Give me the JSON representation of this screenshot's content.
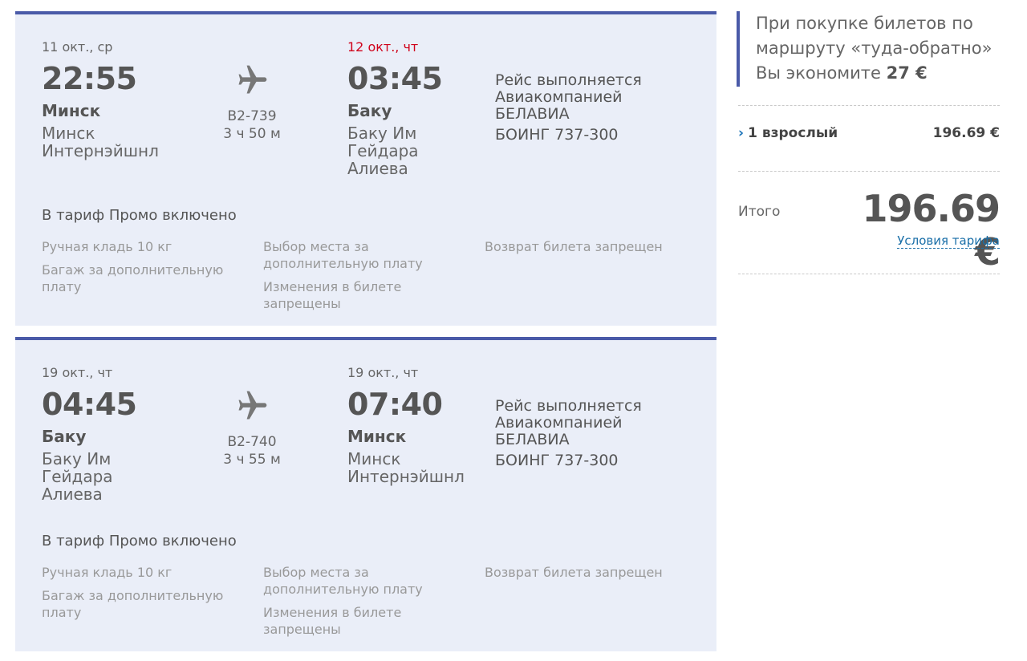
{
  "flights": [
    {
      "dep_date": "11 окт., ср",
      "dep_time": "22:55",
      "dep_city": "Минск",
      "dep_airport": "Минск Интернэйшнл",
      "flight_number": "B2-739",
      "duration": "3 ч 50 м",
      "arr_date": "12 окт., чт",
      "arr_time": "03:45",
      "arr_city": "Баку",
      "arr_airport": "Баку Им Гейдара Алиева",
      "operator": "Рейс выполняется Авиакомпанией БЕЛАВИА",
      "aircraft": "БОИНГ 737-300",
      "tariff_title": "В тариф Промо включено",
      "inc_col1_a": "Ручная кладь 10 кг",
      "inc_col1_b": "Багаж за дополнительную плату",
      "inc_col2_a": "Выбор места за дополнительную плату",
      "inc_col2_b": "Изменения в билете запрещены",
      "inc_col3_a": "Возврат билета запрещен"
    },
    {
      "dep_date": "19 окт., чт",
      "dep_time": "04:45",
      "dep_city": "Баку",
      "dep_airport": "Баку Им Гейдара Алиева",
      "flight_number": "B2-740",
      "duration": "3 ч 55 м",
      "arr_date": "19 окт., чт",
      "arr_time": "07:40",
      "arr_city": "Минск",
      "arr_airport": "Минск Интернэйшнл",
      "operator": "Рейс выполняется Авиакомпанией БЕЛАВИА",
      "aircraft": "БОИНГ 737-300",
      "tariff_title": "В тариф Промо включено",
      "inc_col1_a": "Ручная кладь 10 кг",
      "inc_col1_b": "Багаж за дополнительную плату",
      "inc_col2_a": "Выбор места за дополнительную плату",
      "inc_col2_b": "Изменения в билете запрещены",
      "inc_col3_a": "Возврат билета запрещен"
    }
  ],
  "sidebar": {
    "promo_text": "При покупке билетов по маршруту «туда-обратно» Вы экономите",
    "promo_amount": "27 €",
    "passenger_label": "1 взрослый",
    "passenger_price": "196.69 €",
    "total_label": "Итого",
    "total_value": "196.69 €",
    "terms_link": "Условия тарифа"
  },
  "colors": {
    "card_bg": "#eaeef8",
    "card_border": "#4a5aa8",
    "next_day_date": "#d0021b",
    "link": "#1a6fa8"
  }
}
